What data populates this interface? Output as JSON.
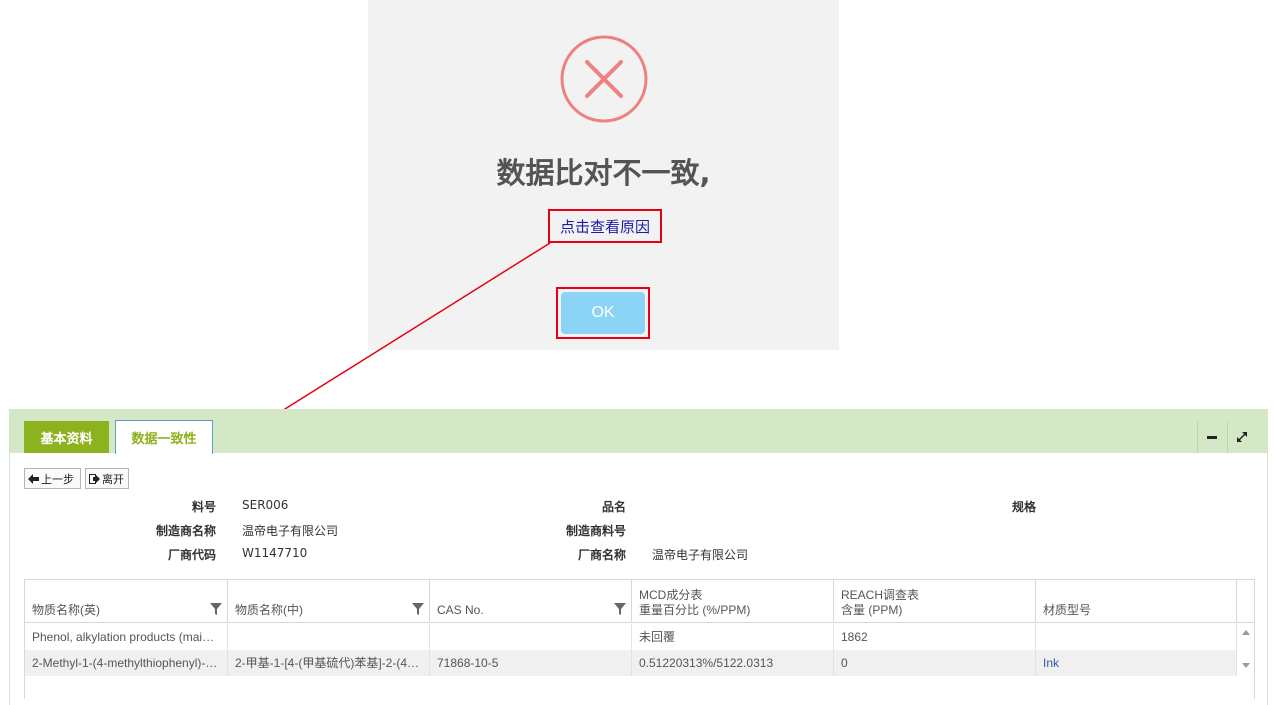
{
  "dialog": {
    "title": "数据比对不一致,",
    "reason_link": "点击查看原因",
    "ok_label": "OK",
    "icon": "error-x-circle-icon",
    "icon_color": "#f08080",
    "ok_color": "#8cd4f5",
    "highlight_color": "#e60012"
  },
  "tabs": [
    {
      "label": "基本资料",
      "active": false
    },
    {
      "label": "数据一致性",
      "active": true
    }
  ],
  "toolbar": {
    "minimize_icon": "minimize-icon",
    "maximize_icon": "expand-icon"
  },
  "nav": {
    "prev_label": "上一步",
    "leave_label": "离开"
  },
  "info": {
    "part_no_label": "料号",
    "part_no_value": "SER006",
    "product_name_label": "品名",
    "product_name_value": "",
    "spec_label": "规格",
    "spec_value": "",
    "manufacturer_name_label": "制造商名称",
    "manufacturer_name_value": "温帝电子有限公司",
    "manufacturer_part_label": "制造商料号",
    "manufacturer_part_value": "",
    "vendor_code_label": "厂商代码",
    "vendor_code_value": "W1147710",
    "vendor_name_label": "厂商名称",
    "vendor_name_value": "温帝电子有限公司"
  },
  "grid": {
    "headers": [
      {
        "line1": "",
        "line2": "物质名称(英)",
        "filter": true
      },
      {
        "line1": "",
        "line2": "物质名称(中)",
        "filter": true
      },
      {
        "line1": "",
        "line2": "CAS No.",
        "filter": true
      },
      {
        "line1": "MCD成分表",
        "line2": "重量百分比 (%/PPM)",
        "filter": false
      },
      {
        "line1": "REACH调查表",
        "line2": "含量 (PPM)",
        "filter": false
      },
      {
        "line1": "",
        "line2": "材质型号",
        "filter": false
      }
    ],
    "rows": [
      [
        "Phenol, alkylation products (main…",
        "",
        "",
        "未回覆",
        "1862",
        ""
      ],
      [
        "2-Methyl-1-(4-methylthiophenyl)-…",
        "2-甲基-1-[4-(甲基硫代)苯基]-2-(4…",
        "71868-10-5",
        "0.51220313%/5122.0313",
        "0",
        "Ink"
      ]
    ]
  },
  "colors": {
    "tabbar_bg": "#d4e8c5",
    "active_tab_text": "#8cb21f",
    "basic_tab_bg": "#8cb21f"
  }
}
